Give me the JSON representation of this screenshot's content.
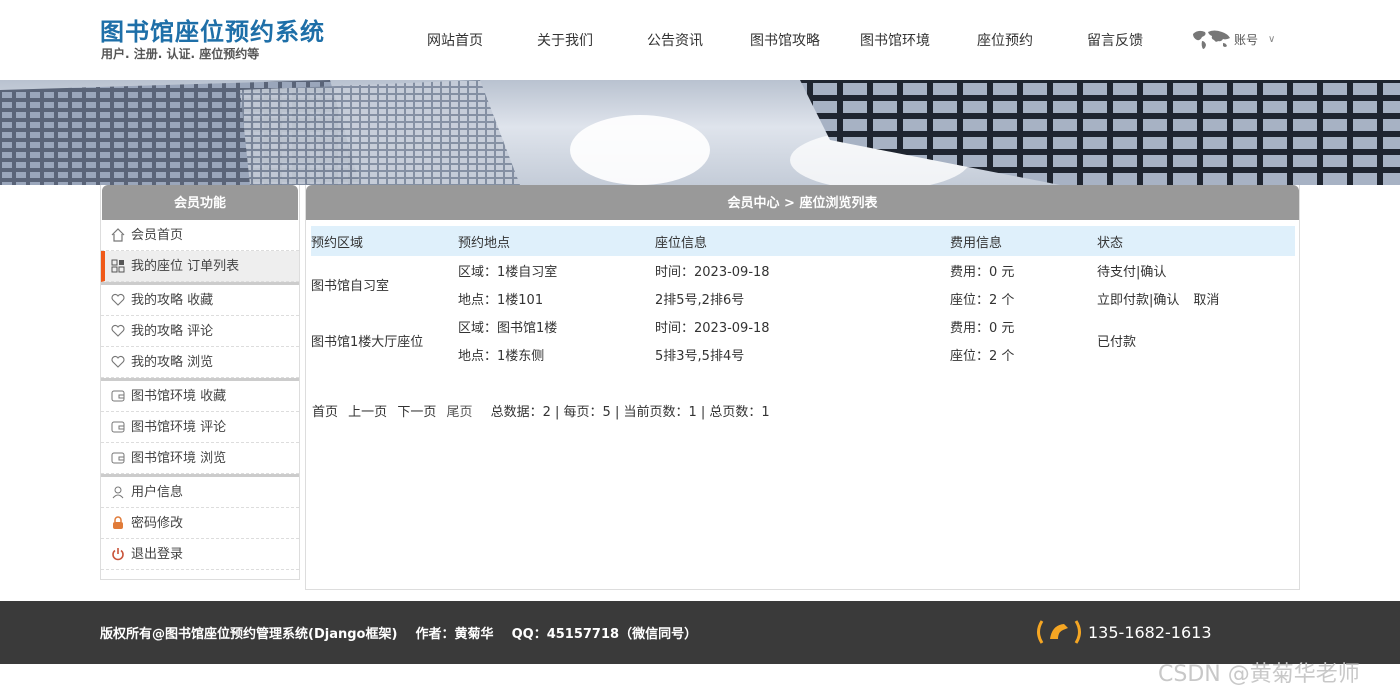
{
  "header": {
    "title": "图书馆座位预约系统",
    "subtitle": "用户. 注册. 认证. 座位预约等",
    "nav": [
      "网站首页",
      "关于我们",
      "公告资讯",
      "图书馆攻略",
      "图书馆环境",
      "座位预约",
      "留言反馈"
    ],
    "account_label": "账号"
  },
  "sidebar": {
    "title": "会员功能",
    "items": [
      {
        "label": "会员首页",
        "icon": "home-icon"
      },
      {
        "label": "我的座位 订单列表",
        "icon": "grid-icon",
        "active": true
      },
      {
        "label": "我的攻略 收藏",
        "icon": "heart-icon"
      },
      {
        "label": "我的攻略 评论",
        "icon": "heart-icon"
      },
      {
        "label": "我的攻略 浏览",
        "icon": "heart-icon"
      },
      {
        "label": "图书馆环境 收藏",
        "icon": "wallet-icon"
      },
      {
        "label": "图书馆环境 评论",
        "icon": "wallet-icon"
      },
      {
        "label": "图书馆环境 浏览",
        "icon": "wallet-icon"
      },
      {
        "label": "用户信息",
        "icon": "user-icon"
      },
      {
        "label": "密码修改",
        "icon": "lock-icon"
      },
      {
        "label": "退出登录",
        "icon": "power-icon"
      }
    ]
  },
  "main": {
    "title": "会员中心 > 座位浏览列表",
    "columns": [
      "预约区域",
      "预约地点",
      "座位信息",
      "费用信息",
      "状态"
    ],
    "rows": [
      {
        "area": "图书馆自习室",
        "zone": "区域：1楼自习室",
        "place": "地点：1楼101",
        "time": "时间：2023-09-18",
        "seats": "2排5号,2排6号",
        "fee": "费用：0 元",
        "count": "座位：2 个",
        "status1": "待支付|确认",
        "action_pay": "立即付款|确认",
        "action_cancel": "取消"
      },
      {
        "area": "图书馆1楼大厅座位",
        "zone": "区域：图书馆1楼",
        "place": "地点：1楼东侧",
        "time": "时间：2023-09-18",
        "seats": "5排3号,5排4号",
        "fee": "费用：0 元",
        "count": "座位：2 个",
        "status": "已付款"
      }
    ],
    "pager": {
      "first": "首页",
      "prev": "上一页",
      "next": "下一页",
      "last": "尾页",
      "summary": "总数据：2 | 每页：5 | 当前页数：1 | 总页数：1"
    }
  },
  "footer": {
    "text": "版权所有@图书馆座位预约管理系统(Django框架)    作者：黄菊华    QQ：45157718（微信同号）",
    "phone": "135-1682-1613",
    "watermark": "CSDN @黄菊华老师"
  },
  "colors": {
    "brand": "#1e6fa8",
    "accent": "#f05a1a",
    "phone_icon": "#f5a623",
    "header_bg": "#999999",
    "table_head": "#dff0fb"
  }
}
